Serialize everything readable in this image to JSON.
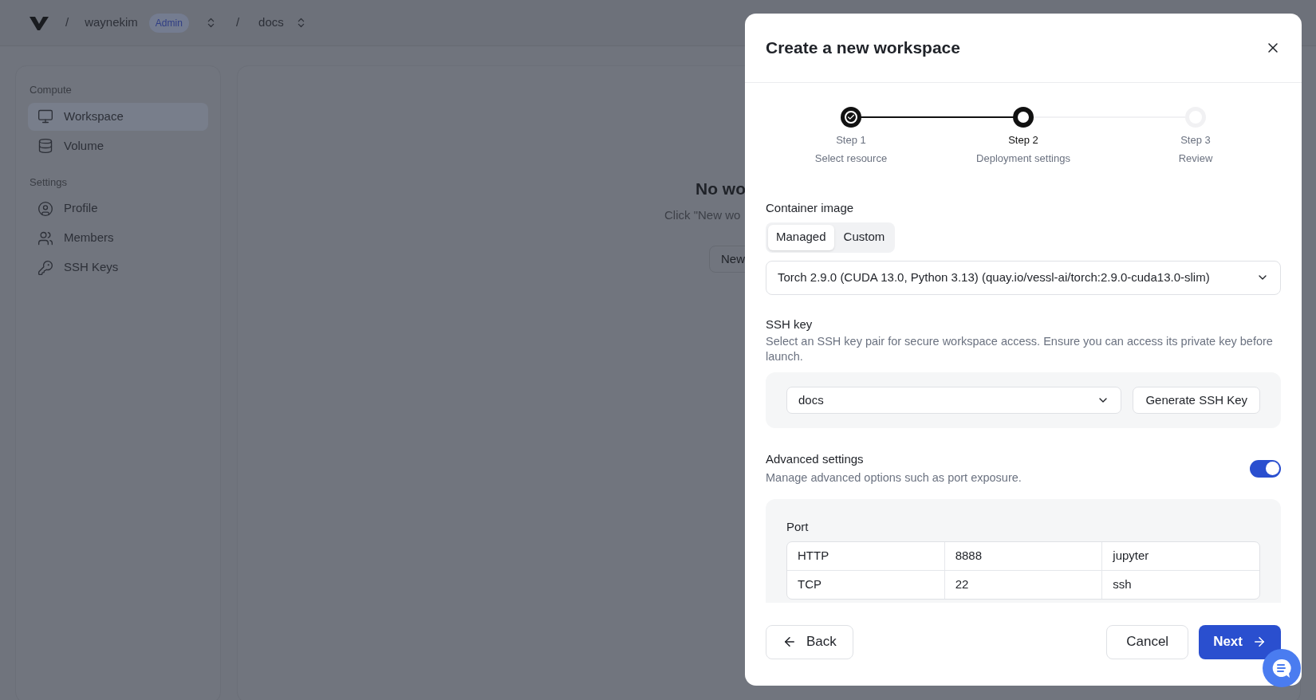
{
  "breadcrumb": {
    "separators": [
      "/",
      "/"
    ],
    "org": "waynekim",
    "role": "Admin",
    "project": "docs"
  },
  "sidebar": {
    "sections": [
      {
        "title": "Compute",
        "items": [
          {
            "label": "Workspace",
            "selected": true
          },
          {
            "label": "Volume",
            "selected": false
          }
        ]
      },
      {
        "title": "Settings",
        "items": [
          {
            "label": "Profile",
            "selected": false
          },
          {
            "label": "Members",
            "selected": false
          },
          {
            "label": "SSH Keys",
            "selected": false
          }
        ]
      }
    ]
  },
  "empty_state": {
    "title": "No wo",
    "text": "Click \"New wo",
    "button": "New"
  },
  "dialog": {
    "title": "Create a new workspace",
    "steps": [
      {
        "label": "Step 1",
        "caption": "Select resource",
        "kind": "done"
      },
      {
        "label": "Step 2",
        "caption": "Deployment settings",
        "kind": "current"
      },
      {
        "label": "Step 3",
        "caption": "Review",
        "kind": "upcoming"
      }
    ],
    "container_image": {
      "label": "Container image",
      "tabs": [
        {
          "label": "Managed",
          "selected": true
        },
        {
          "label": "Custom",
          "selected": false
        }
      ],
      "value": "Torch 2.9.0 (CUDA 13.0, Python 3.13) (quay.io/vessl-ai/torch:2.9.0-cuda13.0-slim)"
    },
    "ssh_key": {
      "label": "SSH key",
      "description": "Select an SSH key pair for secure workspace access. Ensure you can access its private key before launch.",
      "value": "docs",
      "button": "Generate SSH Key"
    },
    "advanced": {
      "label": "Advanced settings",
      "description": "Manage advanced options such as port exposure.",
      "on": true
    },
    "port": {
      "label": "Port",
      "rows": [
        [
          "HTTP",
          "8888",
          "jupyter"
        ],
        [
          "TCP",
          "22",
          "ssh"
        ]
      ]
    },
    "buttons": {
      "back": "Back",
      "cancel": "Cancel",
      "next": "Next"
    }
  }
}
